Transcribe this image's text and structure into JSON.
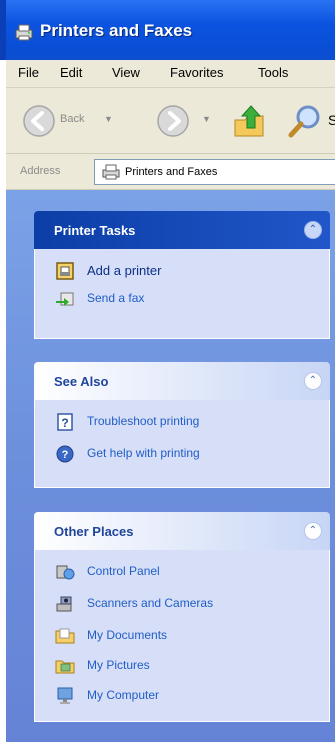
{
  "window": {
    "title": "Printers and Faxes"
  },
  "menu": {
    "items": [
      "File",
      "Edit",
      "View",
      "Favorites",
      "Tools"
    ]
  },
  "toolbar": {
    "back_label": "Back",
    "search_label": "S"
  },
  "address": {
    "label": "Address",
    "value": "Printers and Faxes"
  },
  "panels": {
    "printer_tasks": {
      "title": "Printer Tasks",
      "links": [
        {
          "label": "Add a printer",
          "icon": "add-printer-icon"
        },
        {
          "label": "Send a fax",
          "icon": "send-fax-icon"
        }
      ]
    },
    "see_also": {
      "title": "See Also",
      "links": [
        {
          "label": "Troubleshoot printing",
          "icon": "help-book-icon"
        },
        {
          "label": "Get help with printing",
          "icon": "help-globe-icon"
        }
      ]
    },
    "other_places": {
      "title": "Other Places",
      "links": [
        {
          "label": "Control Panel",
          "icon": "control-panel-icon"
        },
        {
          "label": "Scanners and Cameras",
          "icon": "scanner-camera-icon"
        },
        {
          "label": "My Documents",
          "icon": "folder-icon"
        },
        {
          "label": "My Pictures",
          "icon": "pictures-folder-icon"
        },
        {
          "label": "My Computer",
          "icon": "computer-icon"
        }
      ]
    }
  },
  "colors": {
    "titlebar": "#0b53e0",
    "panel_bg": "#6f93dd",
    "box_body": "#d6dff7",
    "link": "#215dc6",
    "header_special": "#0c3ea6"
  }
}
